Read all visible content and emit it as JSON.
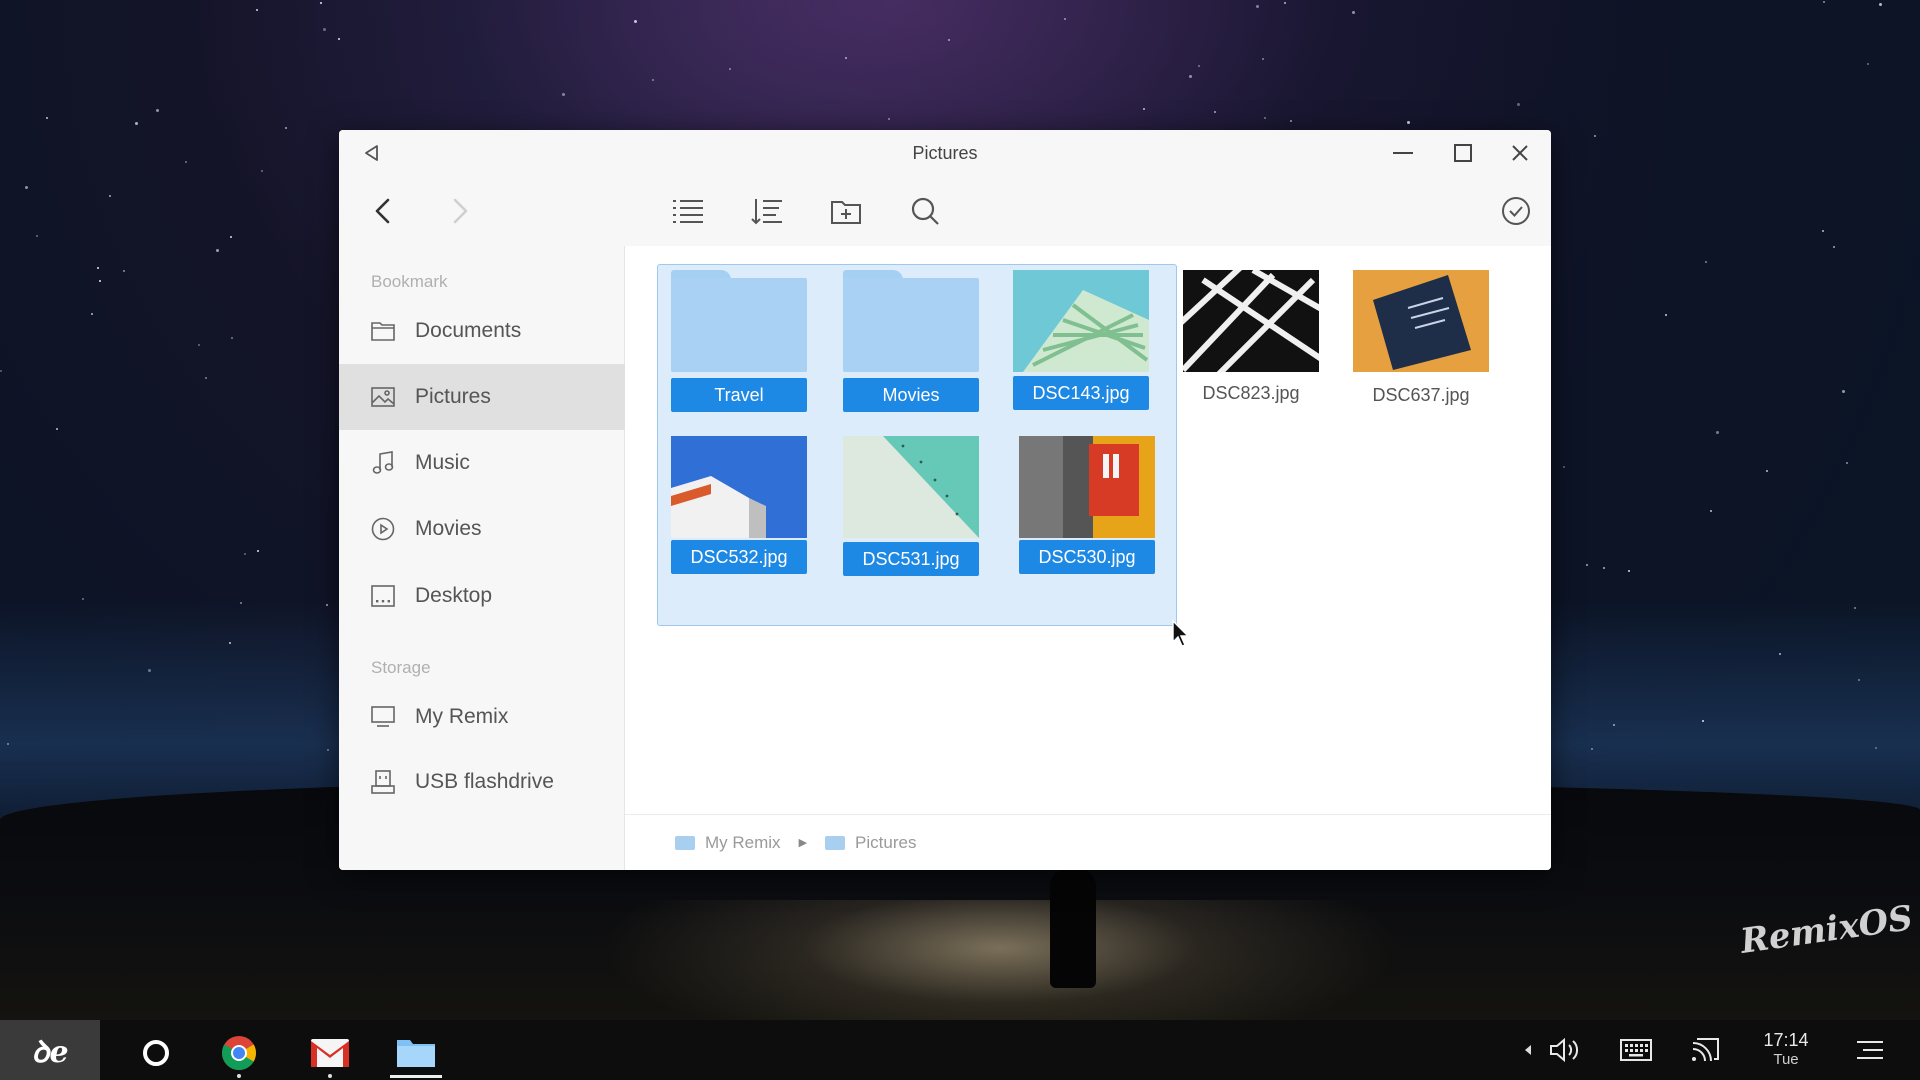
{
  "window": {
    "title": "Pictures"
  },
  "sidebar": {
    "bookmark_label": "Bookmark",
    "storage_label": "Storage",
    "bookmarks": [
      {
        "label": "Documents",
        "icon": "folder-icon"
      },
      {
        "label": "Pictures",
        "icon": "image-icon",
        "active": true
      },
      {
        "label": "Music",
        "icon": "music-note-icon"
      },
      {
        "label": "Movies",
        "icon": "play-circle-icon"
      },
      {
        "label": "Desktop",
        "icon": "desktop-icon"
      }
    ],
    "storage": [
      {
        "label": "My Remix",
        "icon": "monitor-icon"
      },
      {
        "label": "USB flashdrive",
        "icon": "usb-drive-icon"
      }
    ]
  },
  "files": [
    {
      "name": "Travel",
      "type": "folder",
      "selected": true
    },
    {
      "name": "Movies",
      "type": "folder",
      "selected": true
    },
    {
      "name": "DSC143.jpg",
      "type": "image",
      "selected": true
    },
    {
      "name": "DSC823.jpg",
      "type": "image",
      "selected": false
    },
    {
      "name": "DSC637.jpg",
      "type": "image",
      "selected": false
    },
    {
      "name": "DSC532.jpg",
      "type": "image",
      "selected": true
    },
    {
      "name": "DSC531.jpg",
      "type": "image",
      "selected": true
    },
    {
      "name": "DSC530.jpg",
      "type": "image",
      "selected": true
    }
  ],
  "breadcrumb": {
    "items": [
      "My Remix",
      "Pictures"
    ]
  },
  "taskbar": {
    "start_label": "ꝺe",
    "apps": [
      "circle-app-icon",
      "chrome-icon",
      "gmail-icon",
      "files-icon"
    ],
    "clock_time": "17:14",
    "clock_day": "Tue"
  },
  "wallpaper": {
    "logo_text": "RemixOS"
  },
  "colors": {
    "accent": "#1e88e5",
    "selection": "#9fc8ec",
    "folder": "#a9d1f3"
  }
}
